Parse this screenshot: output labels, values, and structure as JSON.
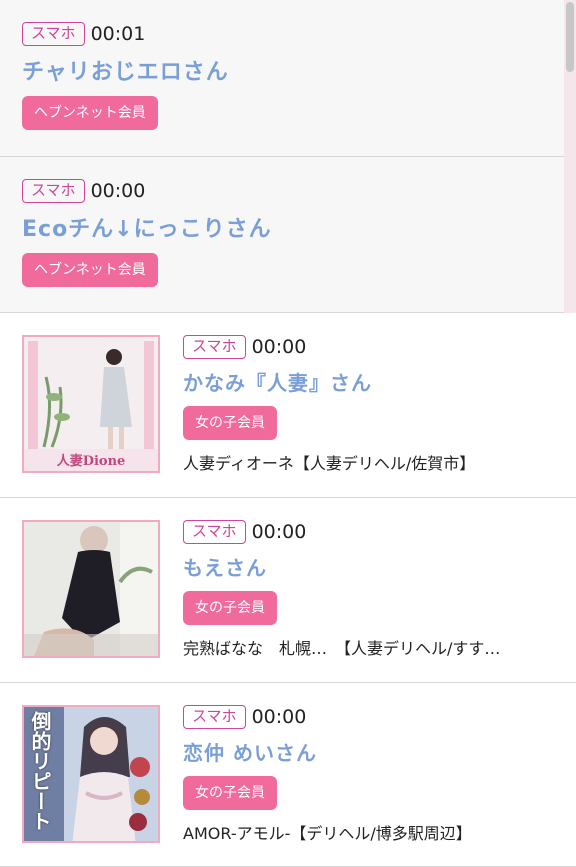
{
  "items": [
    {
      "device": "スマホ",
      "time": "00:01",
      "name": "チャリおじエロさん",
      "badge": "ヘブンネット会員"
    },
    {
      "device": "スマホ",
      "time": "00:00",
      "name": "Ecoチん↓にっこりさん",
      "badge": "ヘブンネット会員"
    },
    {
      "device": "スマホ",
      "time": "00:00",
      "name": "かなみ『人妻』さん",
      "badge": "女の子会員",
      "shop": "人妻ディオーネ【人妻デリヘル/佐賀市】",
      "image_text": "人妻Dione"
    },
    {
      "device": "スマホ",
      "time": "00:00",
      "name": "もえさん",
      "badge": "女の子会員",
      "shop": "完熟ばなな　札幌…　【人妻デリヘル/すす…"
    },
    {
      "device": "スマホ",
      "time": "00:00",
      "name": "恋仲 めいさん",
      "badge": "女の子会員",
      "shop": "AMOR-アモル-【デリヘル/博多駅周辺】",
      "image_text": "倒的リピート"
    }
  ]
}
